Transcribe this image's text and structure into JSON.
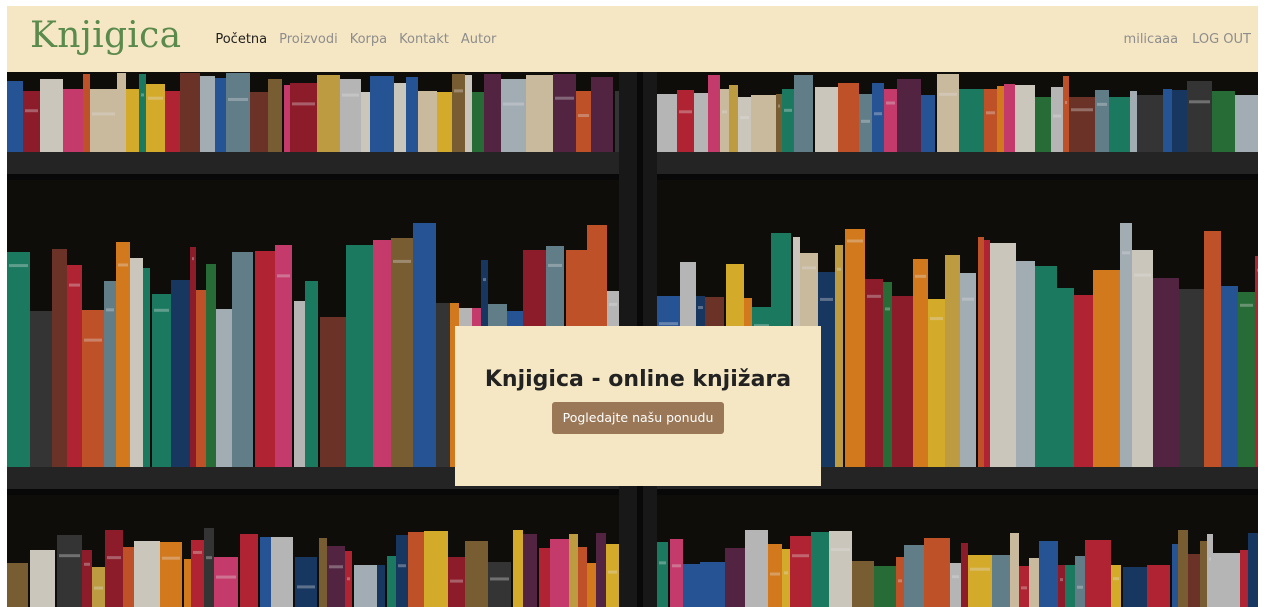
{
  "navbar": {
    "brand": "Knjigica",
    "links": [
      {
        "label": "Početna",
        "active": true
      },
      {
        "label": "Proizvodi"
      },
      {
        "label": "Korpa"
      },
      {
        "label": "Kontakt"
      },
      {
        "label": "Autor"
      }
    ],
    "user": "milicaaa",
    "logout": "LOG OUT"
  },
  "hero": {
    "title": "Knjigica - online knjižara",
    "button": "Pogledajte našu ponudu"
  },
  "colors": {
    "navbar_bg": "#f6e7c4",
    "brand": "#5a8a4c",
    "button_bg": "#9a7756",
    "shelf": "#1c1c1c"
  }
}
